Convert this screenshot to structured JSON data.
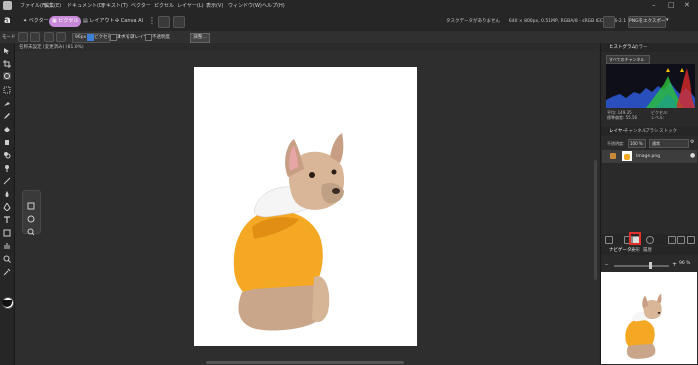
{
  "menu": [
    "ファイル(F)",
    "編集(E)",
    "ドキュメント(D)",
    "テキスト(T)",
    "ベクター",
    "ピクセル",
    "レイヤー(L)",
    "表示(V)",
    "ウィンドウ(W)",
    "ヘルプ(H)"
  ],
  "personas": {
    "vector": "ベクター",
    "pixel": "ピクセル",
    "layout": "レイアウト",
    "canva": "Canva AI"
  },
  "doc_info": "タスクデータがありません　　640 × 800px, 0.51MP, RGBA/8 - sRGB IEC61966-2.1",
  "export_label": "PNGをエクスポート",
  "context": {
    "mode": "モード",
    "size": "96px",
    "align": "ピクセルにスナップ",
    "other_layers": "すべてのレイヤー",
    "opacity": "不透明度",
    "btn": "調整..."
  },
  "doc_tab": "名称未設定 (変更済み) (81.0%)",
  "panels": {
    "histogram_tabs": [
      "ヒストグラム",
      "カラー"
    ],
    "channel_label": "すべてのチャンネル",
    "hist_stats": [
      "平均: 149.35",
      "標準偏差: 55.56",
      "ピクセル:",
      "レベル:"
    ],
    "layer_tabs": [
      "レイヤー",
      "チャンネル",
      "ブラシ",
      "ストック"
    ],
    "layer_opacity_label": "不透明度:",
    "layer_opacity_value": "100 %",
    "blend_mode": "通常",
    "layer_name": "Image.png",
    "nav_tabs": [
      "ナビゲーター",
      "変形",
      "履歴"
    ],
    "zoom": "96 %"
  },
  "colors": {
    "accent": "#c88ad8",
    "highlight": "#e0322b",
    "dog_shirt": "#f4a823"
  }
}
